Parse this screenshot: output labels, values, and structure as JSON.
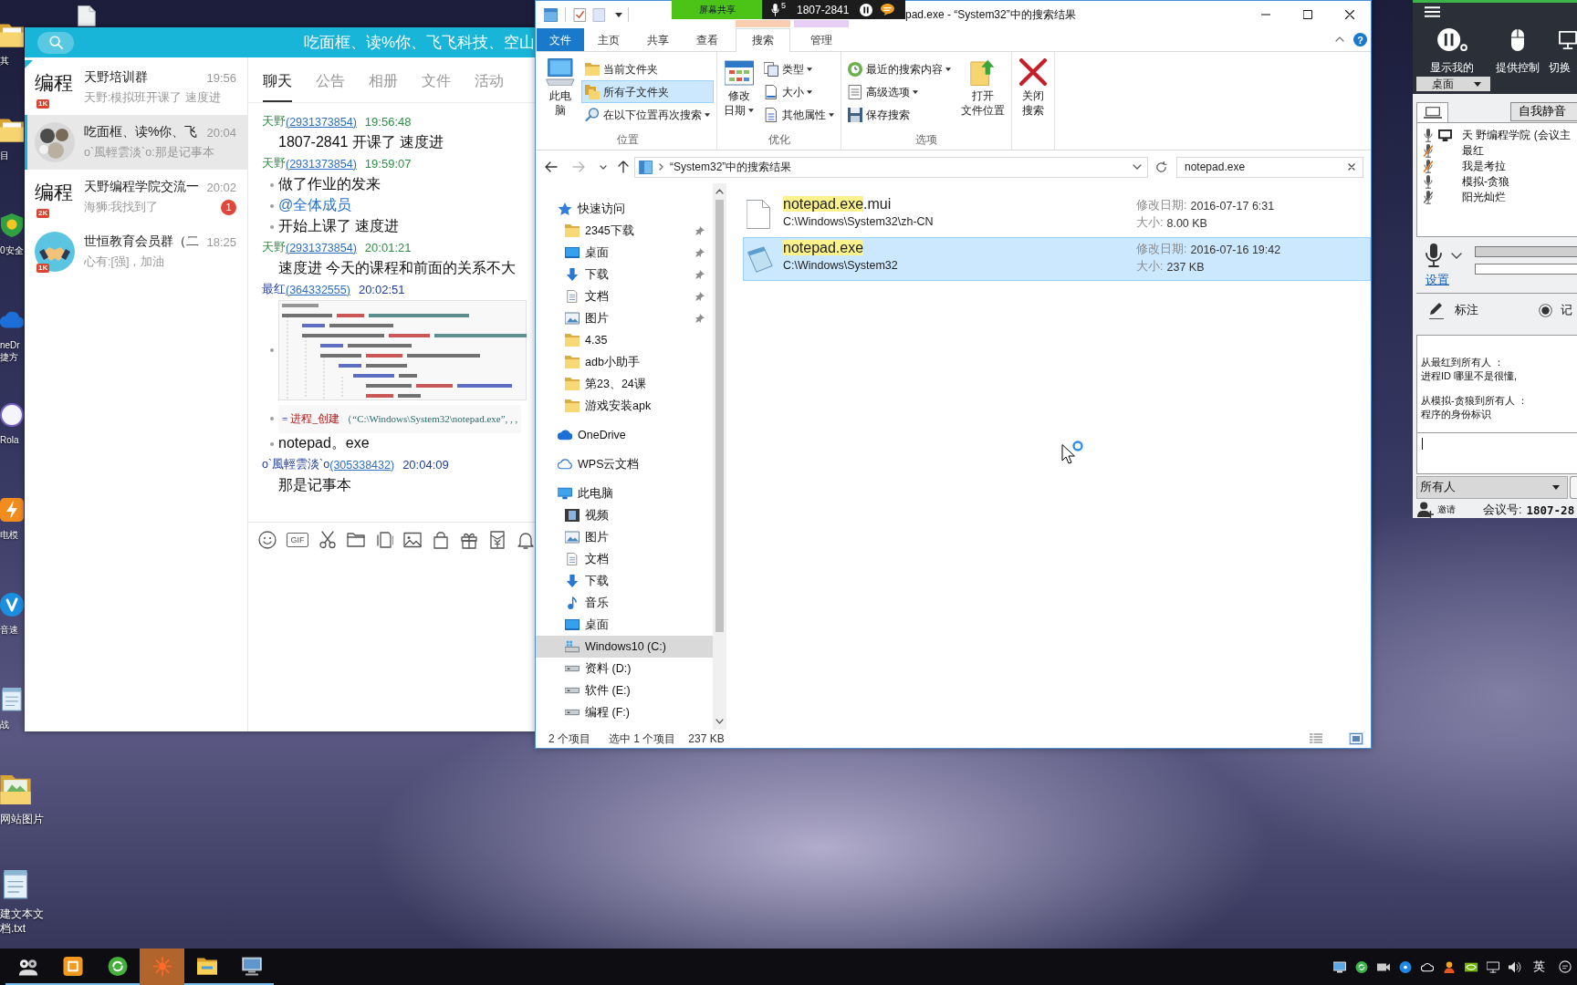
{
  "desktop": {
    "icons": [
      {
        "kind": "folder",
        "label_lines": [
          "其"
        ]
      },
      {
        "kind": "folder",
        "label_lines": [
          "目"
        ]
      },
      {
        "kind": "security",
        "label_lines": [
          "0安全"
        ]
      },
      {
        "kind": "cloud",
        "label_lines": [
          "neDr",
          "捷方"
        ]
      },
      {
        "kind": "ring",
        "label_lines": [
          "Rola"
        ]
      },
      {
        "kind": "emulator",
        "label_lines": [
          "电模"
        ]
      },
      {
        "kind": "launcher",
        "label_lines": [
          "音速"
        ]
      },
      {
        "kind": "notepad",
        "label_lines": [
          "战"
        ]
      },
      {
        "kind": "photo-folder",
        "label_lines": [
          "网站图片"
        ]
      },
      {
        "kind": "notepad",
        "label_lines": [
          "建文本文",
          "档.txt"
        ]
      }
    ]
  },
  "chat_app": {
    "title": "吃面框、读%你、飞飞科技、空山",
    "conversations": [
      {
        "kind": "text",
        "avatar_text": "编程",
        "level_badge": "1K",
        "name": "天野培训群",
        "time": "19:56",
        "preview": "天野:模拟班开课了 速度进",
        "pinned": true,
        "selected": false
      },
      {
        "kind": "group",
        "name": "吃面框、读%你、飞",
        "time": "20:04",
        "preview": "o`風輕雲淡`o:那是记事本",
        "pinned": false,
        "selected": true
      },
      {
        "kind": "text",
        "avatar_text": "编程",
        "level_badge": "2K",
        "name": "天野编程学院交流一",
        "time": "20:02",
        "preview": "海狮:我找到了",
        "unread": "1",
        "pinned": false,
        "selected": false
      },
      {
        "kind": "handshake",
        "level_badge": "1K",
        "name": "世恒教育会员群（二",
        "time": "18:25",
        "preview": "心有:[强]，加油",
        "pinned": false,
        "selected": false
      }
    ],
    "tabs": [
      {
        "label": "聊天",
        "selected": true
      },
      {
        "label": "公告",
        "selected": false
      },
      {
        "label": "相册",
        "selected": false
      },
      {
        "label": "文件",
        "selected": false
      },
      {
        "label": "活动",
        "selected": false
      }
    ],
    "messages": [
      {
        "sender": "天野",
        "qq": "(2931373854)",
        "time": "19:56:48",
        "color": "#2e8f46",
        "body": [
          {
            "kind": "text",
            "text": "1807-2841 开课了  速度进",
            "bullet": false
          }
        ]
      },
      {
        "sender": "天野",
        "qq": "(2931373854)",
        "time": "19:59:07",
        "color": "#2e8f46",
        "body": [
          {
            "kind": "text",
            "text": "做了作业的发来",
            "bullet": true
          },
          {
            "kind": "mention",
            "text": "@全体成员",
            "bullet": true
          },
          {
            "kind": "text",
            "text": "开始上课了  速度进",
            "bullet": true
          }
        ]
      },
      {
        "sender": "天野",
        "qq": "(2931373854)",
        "time": "20:01:21",
        "color": "#2e8f46",
        "body": [
          {
            "kind": "text",
            "text": "速度进  今天的课程和前面的关系不大",
            "bullet": false
          }
        ]
      },
      {
        "sender": "最红",
        "qq": "(364332555)",
        "time": "20:02:51",
        "color": "#1f3b9e",
        "body": [
          {
            "kind": "code_image",
            "bullet": true
          },
          {
            "kind": "code_line",
            "bullet": true,
            "segments": [
              {
                "text": "=",
                "kind": "op"
              },
              {
                "text": " 进程_创建 ",
                "kind": "fn"
              },
              {
                "text": "（“C:\\Windows\\System32\\notepad.exe”, , ,",
                "kind": "str"
              }
            ]
          },
          {
            "kind": "text",
            "text": "notepad。exe",
            "bullet": true
          }
        ]
      },
      {
        "sender": "o`風輕雲淡`o",
        "qq": "(305338432)",
        "time": "20:04:09",
        "color": "#1f3b9e",
        "body": [
          {
            "kind": "text",
            "text": "那是记事本",
            "bullet": false
          }
        ]
      }
    ],
    "input_tools": [
      {
        "kind": "emoji"
      },
      {
        "kind": "gif",
        "label": "GIF"
      },
      {
        "kind": "scissors"
      },
      {
        "kind": "folder"
      },
      {
        "kind": "shake"
      },
      {
        "kind": "image"
      },
      {
        "kind": "bag"
      },
      {
        "kind": "gift"
      },
      {
        "kind": "redpacket"
      },
      {
        "kind": "bell"
      }
    ]
  },
  "explorer": {
    "title": "pad.exe - “System32”中的搜索结果",
    "help": "?",
    "tabs": [
      {
        "label": "文件",
        "kind": "menu",
        "selected": false
      },
      {
        "label": "主页",
        "kind": "tab",
        "selected": false
      },
      {
        "label": "共享",
        "kind": "tab",
        "selected": false
      },
      {
        "label": "查看",
        "kind": "tab",
        "selected": false
      },
      {
        "label": "搜索",
        "kind": "tab",
        "selected": true,
        "color": "#f8cdb0"
      },
      {
        "label": "管理",
        "kind": "tab",
        "selected": false,
        "color": "#e6cdf3"
      }
    ],
    "ribbon": [
      {
        "label": "位置",
        "items": [
          {
            "kind": "large",
            "label_lines": [
              "此电",
              "脑"
            ],
            "dropdown": false,
            "selected": false
          },
          {
            "kind": "small",
            "label_lines": [
              "当前文件夹"
            ],
            "dropdown": false,
            "selected": false
          },
          {
            "kind": "small",
            "label_lines": [
              "所有子文件夹"
            ],
            "dropdown": false,
            "selected": true
          },
          {
            "kind": "small",
            "label_lines": [
              "在以下位置再次搜索"
            ],
            "dropdown": true,
            "selected": false
          }
        ]
      },
      {
        "label": "优化",
        "items": [
          {
            "kind": "large",
            "label_lines": [
              "修改",
              "日期"
            ],
            "dropdown": true,
            "selected": false
          },
          {
            "kind": "small",
            "label_lines": [
              "类型"
            ],
            "dropdown": true,
            "selected": false
          },
          {
            "kind": "small",
            "label_lines": [
              "大小"
            ],
            "dropdown": true,
            "selected": false
          },
          {
            "kind": "small",
            "label_lines": [
              "其他属性"
            ],
            "dropdown": true,
            "selected": false
          }
        ]
      },
      {
        "label": "选项",
        "items": [
          {
            "kind": "small",
            "label_lines": [
              "最近的搜索内容"
            ],
            "dropdown": true,
            "selected": false
          },
          {
            "kind": "small",
            "label_lines": [
              "高级选项"
            ],
            "dropdown": true,
            "selected": false
          },
          {
            "kind": "small",
            "label_lines": [
              "保存搜索"
            ],
            "dropdown": false,
            "selected": false
          },
          {
            "kind": "large",
            "label_lines": [
              "打开",
              "文件位置"
            ],
            "dropdown": false,
            "selected": false
          }
        ]
      },
      {
        "items": [
          {
            "kind": "large",
            "label_lines": [
              "关闭",
              "搜索"
            ],
            "dropdown": false,
            "selected": false
          }
        ]
      }
    ],
    "nav_buttons": [
      {
        "kind": "back",
        "disabled": false
      },
      {
        "kind": "forward",
        "disabled": true
      },
      {
        "kind": "recent",
        "disabled": false
      },
      {
        "kind": "up",
        "disabled": false
      }
    ],
    "address": {
      "location": "“System32”中的搜索结果"
    },
    "search": {
      "value": "notepad.exe"
    },
    "nav": [
      {
        "label": "快速访问",
        "kind": "star",
        "selected": false,
        "children": [
          {
            "label": "2345下载",
            "kind": "folder",
            "pinned": true,
            "selected": false
          },
          {
            "label": "桌面",
            "kind": "desktop",
            "pinned": true,
            "selected": false
          },
          {
            "label": "下载",
            "kind": "download",
            "pinned": true,
            "selected": false
          },
          {
            "label": "文档",
            "kind": "document",
            "pinned": true,
            "selected": false
          },
          {
            "label": "图片",
            "kind": "picture",
            "pinned": true,
            "selected": false
          },
          {
            "label": "4.35",
            "kind": "folder",
            "pinned": false,
            "selected": false
          },
          {
            "label": "adb小助手",
            "kind": "folder",
            "pinned": false,
            "selected": false
          },
          {
            "label": "第23、24课",
            "kind": "folder",
            "pinned": false,
            "selected": false
          },
          {
            "label": "游戏安装apk",
            "kind": "folder",
            "pinned": false,
            "selected": false
          }
        ]
      },
      {
        "label": "OneDrive",
        "kind": "cloud",
        "selected": false
      },
      {
        "label": "WPS云文档",
        "kind": "cloud-outline",
        "selected": false
      },
      {
        "label": "此电脑",
        "kind": "pc",
        "selected": false,
        "children": [
          {
            "label": "视频",
            "kind": "video",
            "pinned": false,
            "selected": false
          },
          {
            "label": "图片",
            "kind": "picture",
            "pinned": false,
            "selected": false
          },
          {
            "label": "文档",
            "kind": "document",
            "pinned": false,
            "selected": false
          },
          {
            "label": "下载",
            "kind": "download",
            "pinned": false,
            "selected": false
          },
          {
            "label": "音乐",
            "kind": "music",
            "pinned": false,
            "selected": false
          },
          {
            "label": "桌面",
            "kind": "desktop",
            "pinned": false,
            "selected": false
          },
          {
            "label": "Windows10 (C:)",
            "kind": "system-drive",
            "pinned": false,
            "selected": true
          },
          {
            "label": "资料 (D:)",
            "kind": "drive",
            "pinned": false,
            "selected": false
          },
          {
            "label": "软件 (E:)",
            "kind": "drive",
            "pinned": false,
            "selected": false
          },
          {
            "label": "编程 (F:)",
            "kind": "drive",
            "pinned": false,
            "selected": false
          }
        ]
      }
    ],
    "files": [
      {
        "kind": "file",
        "name": [
          {
            "text": "notepad.exe",
            "match": true
          },
          {
            "text": ".mui",
            "match": false
          }
        ],
        "path": "C:\\Windows\\System32\\zh-CN",
        "modified_label": "修改日期:",
        "modified": "2016-07-17 6:31",
        "size_label": "大小:",
        "size": "8.00 KB",
        "selected": false
      },
      {
        "kind": "notepad",
        "name": [
          {
            "text": "notepad.exe",
            "match": true
          }
        ],
        "path": "C:\\Windows\\System32",
        "modified_label": "修改日期:",
        "modified": "2016-07-16 19:42",
        "size_label": "大小:",
        "size": "237 KB",
        "selected": true
      }
    ],
    "status": {
      "count": "2 个项目",
      "selection": "选中 1 个项目",
      "size": "237 KB"
    },
    "views": [
      {
        "kind": "details",
        "selected": false
      },
      {
        "kind": "tiles",
        "selected": true
      }
    ]
  },
  "screen_share": {
    "label": "屏幕共享",
    "count": "5",
    "number": "1807-2841"
  },
  "meeting": {
    "controls": [
      {
        "label": "显示我的",
        "kind": "share"
      },
      {
        "label": "提供控制",
        "kind": "mouse"
      },
      {
        "label": "切换",
        "kind": "monitor"
      }
    ],
    "share_target": "桌面",
    "mute_button": "自我静音",
    "participants": [
      {
        "name": "天 野编程学院 (会议主",
        "kind": "on",
        "presenter": true
      },
      {
        "name": "最红",
        "kind": "muted",
        "presenter": false
      },
      {
        "name": "我是考拉",
        "kind": "muted",
        "presenter": false
      },
      {
        "name": "模拟-贪狼",
        "kind": "on",
        "presenter": false
      },
      {
        "name": "阳光灿烂",
        "kind": "off",
        "presenter": false
      }
    ],
    "meters": [
      {
        "disabled": true
      },
      {
        "disabled": false
      }
    ],
    "settings_link": "设置",
    "annotate": "标注",
    "record": "记",
    "chat_log": [
      {
        "from": "从最红到所有人 ：",
        "text": "进程ID 哪里不是很懂,"
      },
      {
        "from": "从模拟-贪狼到所有人 ：",
        "text": "程序的身份标识"
      }
    ],
    "recipient": "所有人",
    "invite": "邀请",
    "meeting_id_label": "会议号:",
    "meeting_id": "1807-28"
  },
  "taskbar": {
    "apps": [
      {
        "kind": "people",
        "running": true,
        "selected": false
      },
      {
        "kind": "square",
        "running": true,
        "selected": false
      },
      {
        "kind": "refresh",
        "running": true,
        "selected": false
      },
      {
        "kind": "sun",
        "running": false,
        "selected": true
      },
      {
        "kind": "folder",
        "running": true,
        "selected": false
      },
      {
        "kind": "monitor",
        "running": true,
        "selected": false
      }
    ],
    "ime": "英"
  }
}
